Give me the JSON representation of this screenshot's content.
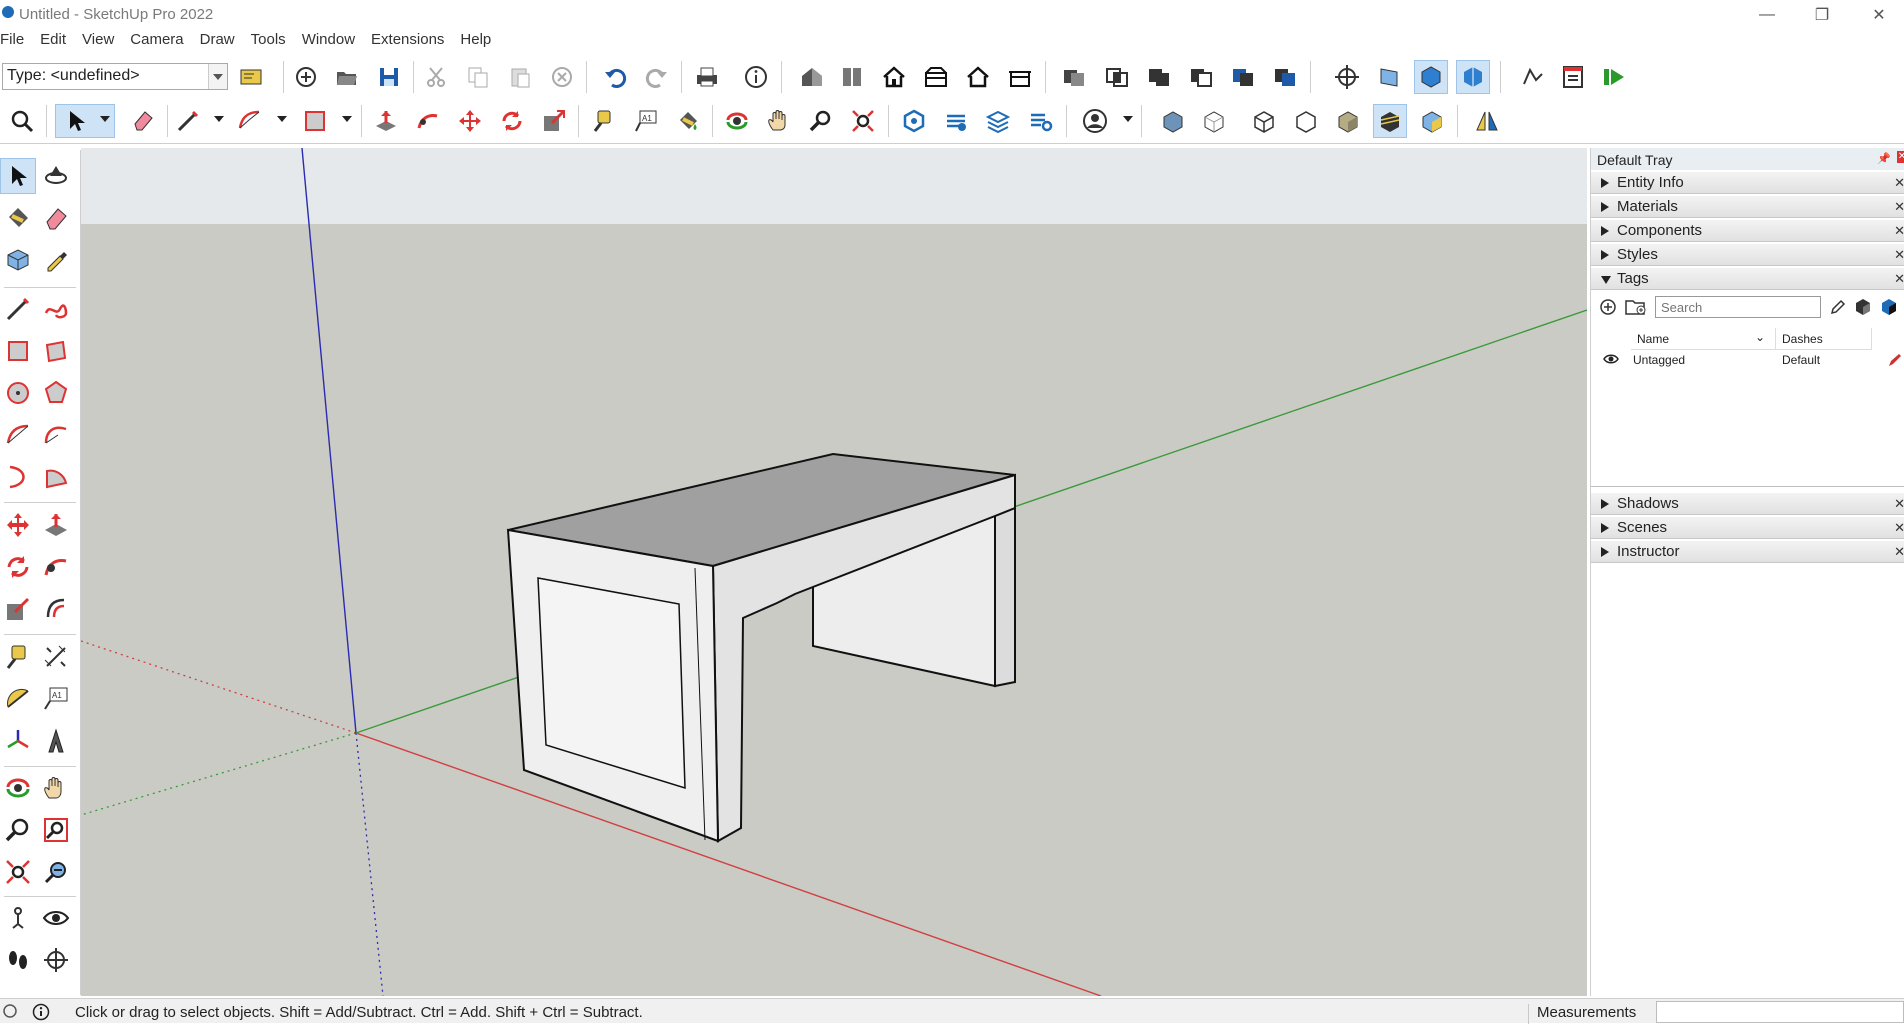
{
  "window": {
    "title": "Untitled - SketchUp Pro 2022",
    "controls": [
      "—",
      "❐",
      "✕"
    ]
  },
  "menu": [
    "File",
    "Edit",
    "View",
    "Camera",
    "Draw",
    "Tools",
    "Window",
    "Extensions",
    "Help"
  ],
  "toolbar": {
    "type_select_value": "Type: <undefined>"
  },
  "tray": {
    "title": "Default Tray",
    "pin_glyph": "📌",
    "close_glyph": "✕",
    "panels_top": [
      {
        "label": "Entity Info"
      },
      {
        "label": "Materials"
      },
      {
        "label": "Components"
      },
      {
        "label": "Styles"
      }
    ],
    "tags_panel": {
      "label": "Tags",
      "search_placeholder": "Search",
      "columns": [
        "Name",
        "Dashes"
      ],
      "rows": [
        {
          "name": "Untagged",
          "dashes": "Default"
        }
      ]
    },
    "panels_bottom": [
      {
        "label": "Shadows"
      },
      {
        "label": "Scenes"
      },
      {
        "label": "Instructor"
      }
    ]
  },
  "status": {
    "hint": "Click or drag to select objects. Shift = Add/Subtract. Ctrl = Add. Shift + Ctrl = Subtract.",
    "measurements_label": "Measurements"
  },
  "colors": {
    "sky": "#e6e9ec",
    "ground": "#cbcbc6",
    "top_face": "#a0a0a0",
    "side_face": "#ececec",
    "axis_red": "#d04040",
    "axis_green": "#3a9a3a",
    "axis_blue": "#2b2bb0",
    "accent_blue": "#1e6bb8"
  }
}
